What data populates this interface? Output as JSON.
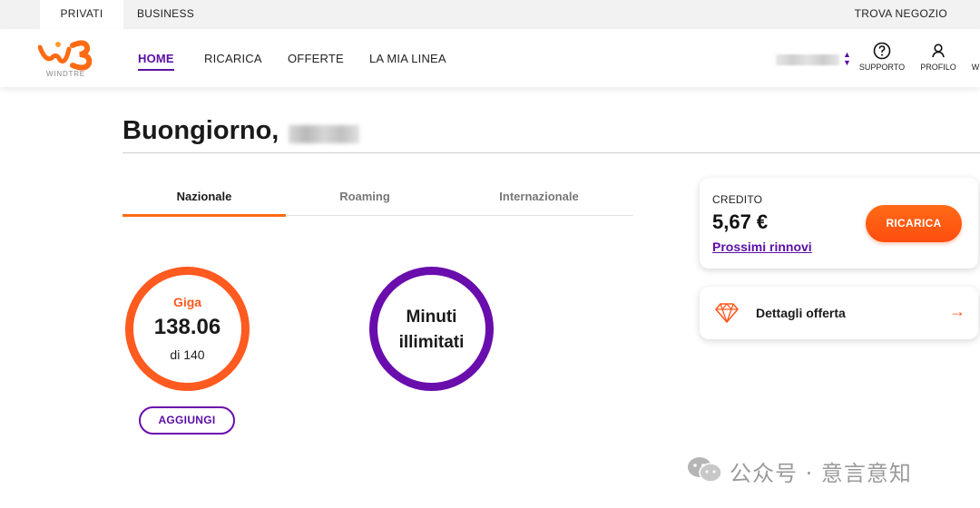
{
  "topbar": {
    "privati": "PRIVATI",
    "business": "BUSINESS",
    "trova_negozio": "TROVA NEGOZIO"
  },
  "header": {
    "logo_text": "WINDTRE",
    "nav": [
      "HOME",
      "RICARICA",
      "OFFERTE",
      "LA MIA LINEA"
    ],
    "supporto": "SUPPORTO",
    "profilo": "PROFILO",
    "cut_label": "W"
  },
  "greeting": "Buongiorno,",
  "tabs": [
    "Nazionale",
    "Roaming",
    "Internazionale"
  ],
  "giga": {
    "label": "Giga",
    "value": "138.06",
    "total": "di 140"
  },
  "minuti": {
    "line1": "Minuti",
    "line2": "illimitati"
  },
  "aggiungi_label": "AGGIUNGI",
  "credit": {
    "label": "CREDITO",
    "value": "5,67 €",
    "link": "Prossimi rinnovi",
    "button": "RICARICA"
  },
  "offerta": {
    "label": "Dettagli offerta",
    "arrow": "→"
  },
  "watermark": {
    "text": "公众号 · 意言意知"
  },
  "colors": {
    "brand_orange": "#ff5a1f",
    "brand_purple": "#6a0dad",
    "link_purple": "#5b0fa6"
  }
}
